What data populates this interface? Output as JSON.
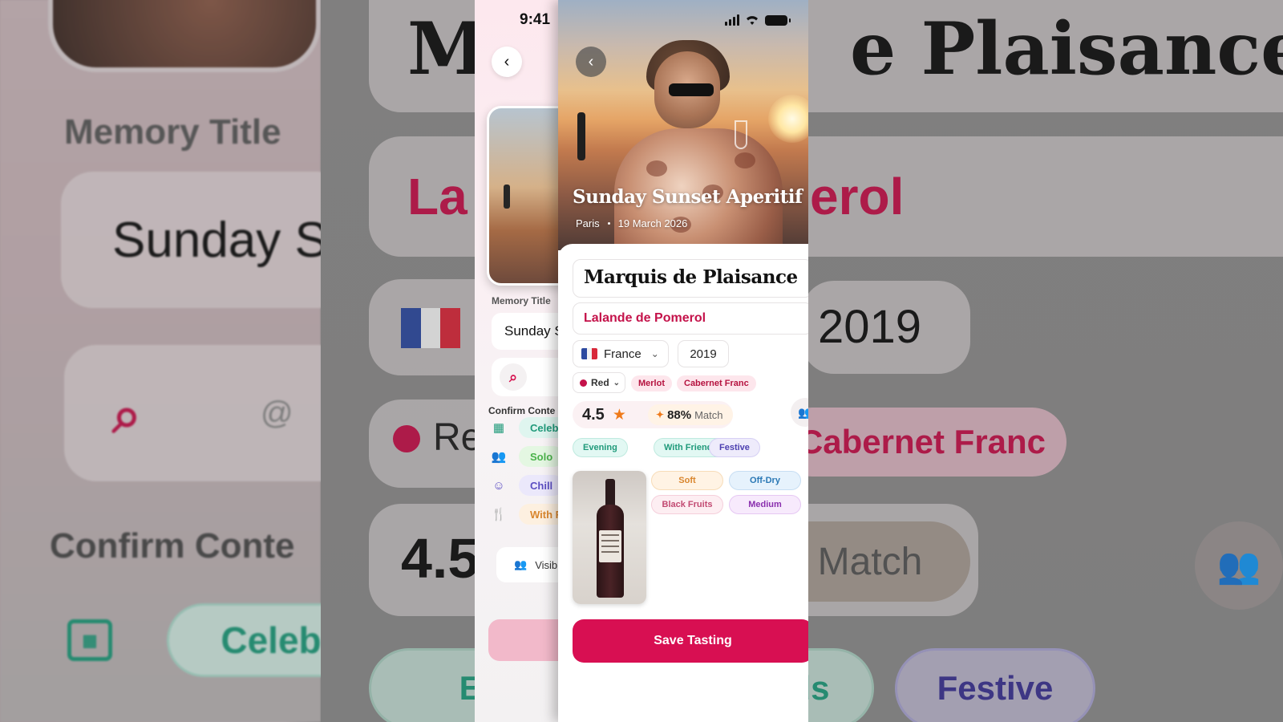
{
  "status_bar": {
    "time": "9:41"
  },
  "background": {
    "wine_name_fragment_left": "M",
    "wine_name_fragment_right": "e Plaisance",
    "memory_title_label": "Memory Title",
    "title_fragment": "Sunday S",
    "appellation_fragment_left": "La",
    "appellation_fragment_right": "erol",
    "vintage": "2019",
    "color_fragment": "Re",
    "grape": "Cabernet Franc",
    "search_at": "@",
    "confirm_context_fragment": "Confirm Conte",
    "rating_fragment": "4.5",
    "match_label": "Match",
    "occasion_fragment": "Celeb",
    "tag_left_fragment": "Eve",
    "tag_mid_fragment": "ds",
    "tag_festive": "Festive"
  },
  "underlying_screen": {
    "memory_title_label": "Memory Title",
    "memory_title_value": "Sunday S",
    "search_at": "@",
    "confirm_context_label": "Confirm Conte",
    "context_rows": [
      {
        "icon": "calendar-icon",
        "glyph": "▦",
        "label": "Celeb",
        "bg": "#dff5ef",
        "fg": "#1f9a7a"
      },
      {
        "icon": "people-icon",
        "glyph": "👥",
        "label": "Solo",
        "bg": "#e4f7e2",
        "fg": "#4ab24a"
      },
      {
        "icon": "smile-icon",
        "glyph": "☺",
        "label": "Chill",
        "bg": "#ebe8fb",
        "fg": "#5b4ec2"
      },
      {
        "icon": "cutlery-icon",
        "glyph": "🍴",
        "label": "With F",
        "bg": "#fdf0e0",
        "fg": "#d9862e"
      }
    ],
    "visibility_label": "Visib"
  },
  "card": {
    "memory_title": "Sunday Sunset Aperitif",
    "location": "Paris",
    "date": "19 March 2026",
    "wine_name": "Marquis de Plaisance",
    "appellation": "Lalande de Pomerol",
    "country": "France",
    "vintage": "2019",
    "wine_color": "Red",
    "grapes": [
      "Merlot",
      "Cabernet Franc"
    ],
    "rating": "4.5",
    "match_percent": "88%",
    "match_label": "Match",
    "tags": [
      {
        "label": "Evening",
        "bg": "#e2f8f3",
        "fg": "#1f9a7a",
        "border": "#bfeadf"
      },
      {
        "label": "With Friends",
        "bg": "#e2f8f3",
        "fg": "#1f9a7a",
        "border": "#bfeadf"
      },
      {
        "label": "Festive",
        "bg": "#eeebfb",
        "fg": "#4c3fb0",
        "border": "#d6d0f4"
      }
    ],
    "tasting_notes": [
      {
        "label": "Soft",
        "bg": "#fff3e4",
        "fg": "#d9862e",
        "border": "#f7dcb8"
      },
      {
        "label": "Off-Dry",
        "bg": "#e6f2fc",
        "fg": "#2a78b5",
        "border": "#c7def3"
      },
      {
        "label": "Black Fruits",
        "bg": "#fdeef2",
        "fg": "#c24a72",
        "border": "#f5cfdb"
      },
      {
        "label": "Medium",
        "bg": "#f7eafc",
        "fg": "#8a2fae",
        "border": "#e6c8f3"
      }
    ],
    "save_button": "Save Tasting"
  },
  "colors": {
    "accent": "#d80f52",
    "accent_text": "#c4124a",
    "star": "#ef7a1a"
  }
}
